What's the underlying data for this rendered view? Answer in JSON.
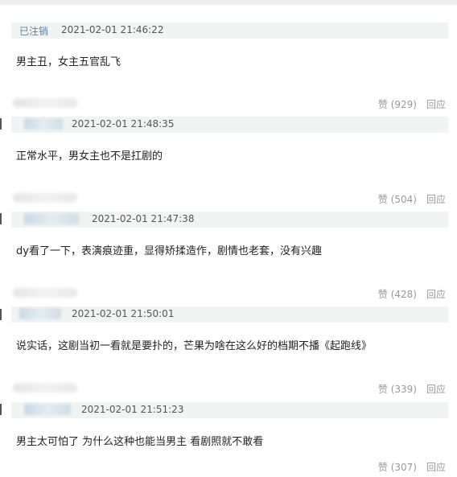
{
  "comments": [
    {
      "user": "已注销",
      "time": "2021-02-01 21:46:22",
      "text": "男主丑，女主五官乱飞",
      "likes": "赞 (929)",
      "reply": "回应"
    },
    {
      "user": "",
      "time": "2021-02-01 21:48:35",
      "text": "正常水平，男女主也不是扛剧的",
      "likes": "赞 (504)",
      "reply": "回应"
    },
    {
      "user": "",
      "time": "2021-02-01 21:47:38",
      "text": "dy看了一下，表演痕迹重，显得矫揉造作，剧情也老套，没有兴趣",
      "likes": "赞 (428)",
      "reply": "回应"
    },
    {
      "user": "",
      "time": "2021-02-01 21:50:01",
      "text": "说实话，这剧当初一看就是要扑的，芒果为啥在这么好的档期不播《起跑线》",
      "likes": "赞 (339)",
      "reply": "回应"
    },
    {
      "user": "",
      "time": "2021-02-01 21:51:23",
      "text": "男主太可怕了 为什么这种也能当男主 看剧照就不敢看",
      "likes": "赞 (307)",
      "reply": "回应"
    }
  ]
}
